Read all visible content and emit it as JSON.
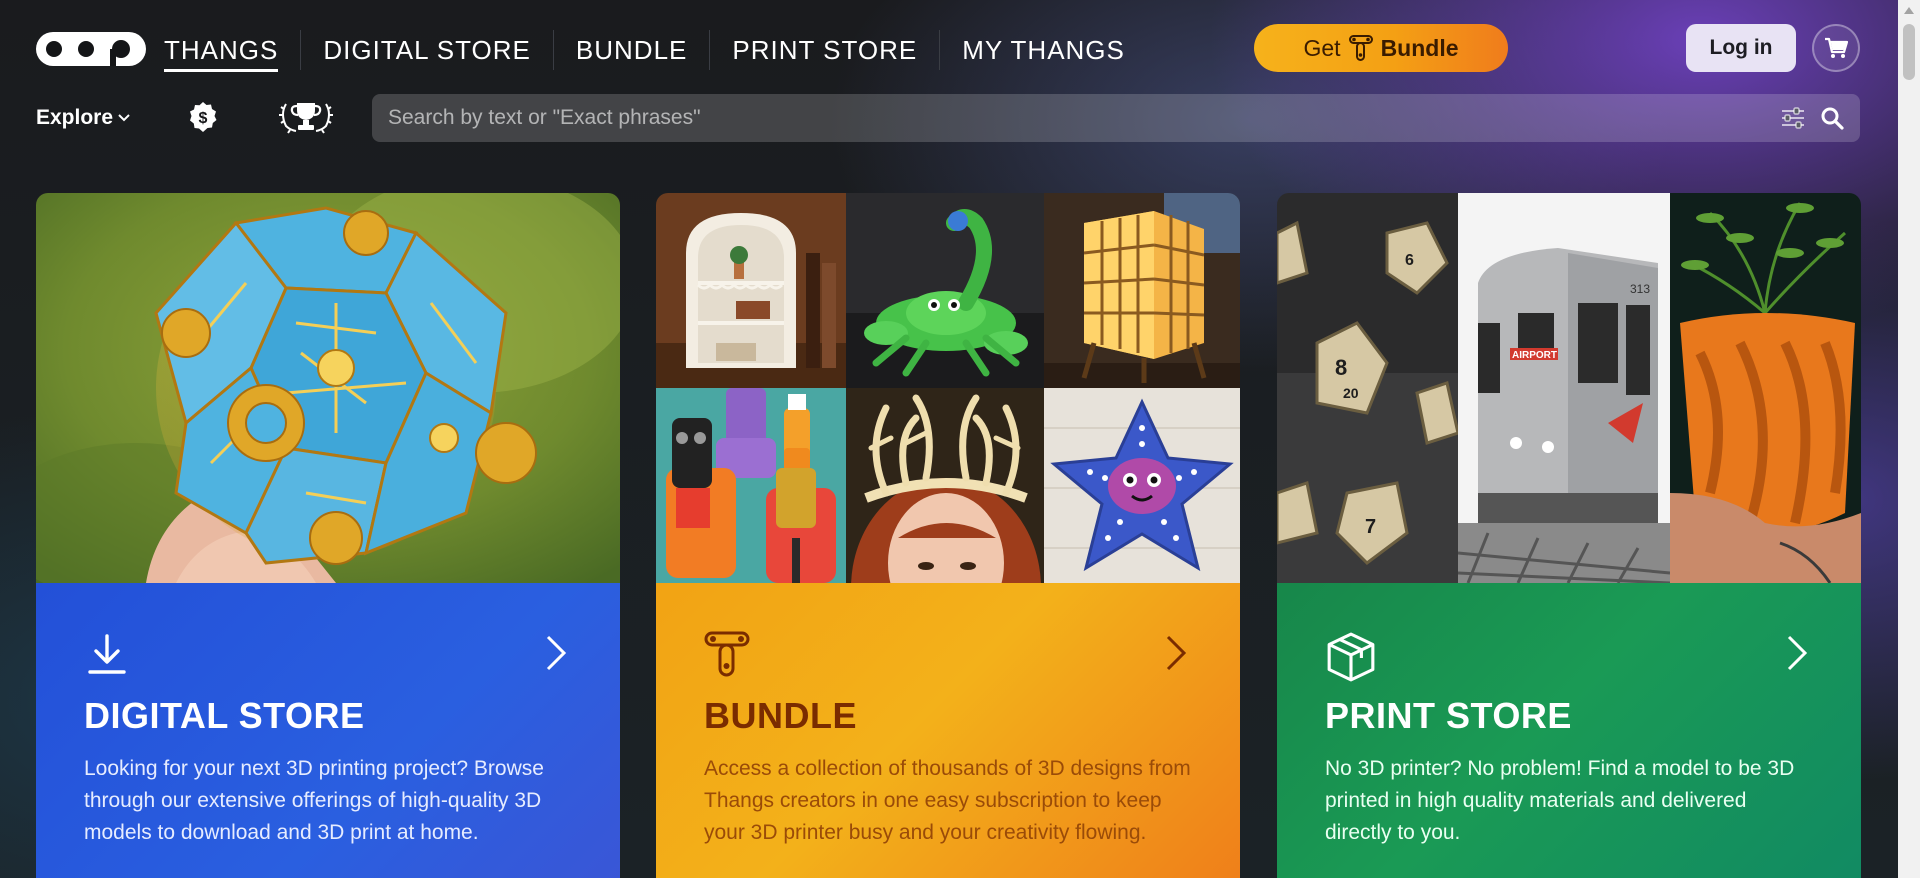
{
  "header": {
    "nav": [
      {
        "label": "THANGS"
      },
      {
        "label": "DIGITAL STORE"
      },
      {
        "label": "BUNDLE"
      },
      {
        "label": "PRINT STORE"
      },
      {
        "label": "MY THANGS"
      }
    ],
    "bundle_cta": {
      "prefix": "Get",
      "bold": "Bundle"
    },
    "login_label": "Log in"
  },
  "toolbar": {
    "explore_label": "Explore",
    "search_placeholder": "Search by text or \"Exact phrases\""
  },
  "cards": [
    {
      "title": "DIGITAL STORE",
      "description": "Looking for your next 3D printing project? Browse through our extensive offerings of high-quality 3D models to download and 3D print at home.",
      "icon": "download-icon"
    },
    {
      "title": "BUNDLE",
      "description": "Access a collection of thousands of 3D designs from Thangs creators in one easy subscription to keep your 3D printer busy and your creativity flowing.",
      "icon": "bundle-logo-icon"
    },
    {
      "title": "PRINT STORE",
      "description": "No 3D printer? No problem! Find a model to be 3D printed in high quality materials and delivered directly to you.",
      "icon": "box-icon"
    }
  ],
  "images": {
    "airport_sign": "AIRPORT",
    "train_number": "313"
  },
  "colors": {
    "accent_orange": "#f4a014",
    "digital_blue": "#2350d8",
    "print_green": "#17874a"
  }
}
